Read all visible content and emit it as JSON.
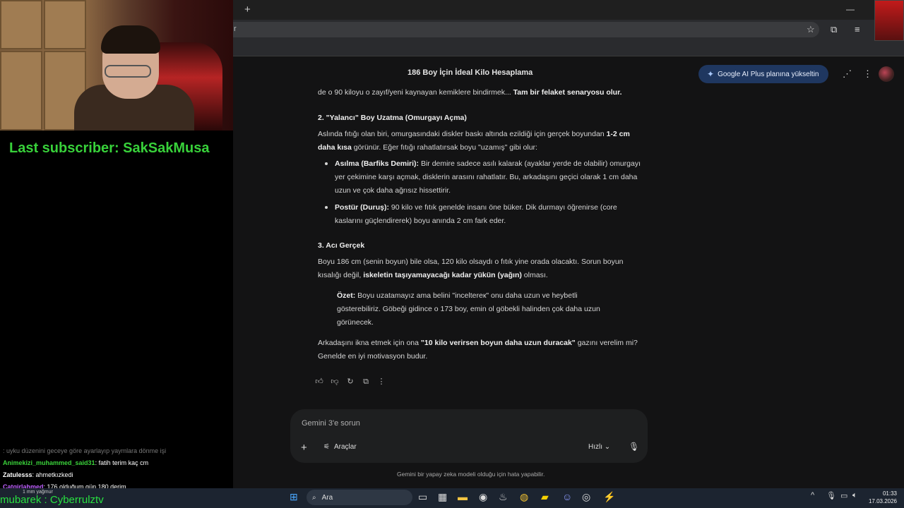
{
  "browser": {
    "new_tab_glyph": "+",
    "address_text": "r",
    "minimize_glyph": "—",
    "maximize_glyph": "▢"
  },
  "gemini": {
    "chat_title": "186 Boy İçin İdeal Kilo Hesaplama",
    "upgrade_label": "Google AI Plus planına yükseltin",
    "input_placeholder": "Gemini 3'e sorun",
    "tools_label": "Araçlar",
    "speed_label": "Hızlı",
    "disclaimer": "Gemini bir yapay zeka modeli olduğu için hata yapabilir."
  },
  "response": {
    "line1_normal": "de o 90 kiloyu o zayıf/yeni kaynayan kemiklere bindirmek... ",
    "line1_bold": "Tam bir felaket senaryosu olur.",
    "h2": "2. \"Yalancı\" Boy Uzatma (Omurgayı Açma)",
    "p2_a": "Aslında fıtığı olan biri, omurgasındaki diskler baskı altında ezildiği için gerçek boyundan ",
    "p2_b": "1-2 cm daha kısa",
    "p2_c": " görünür. Eğer fıtığı rahatlatırsak boyu \"uzamış\" gibi olur:",
    "b1_title": "Asılma (Barfiks Demiri):",
    "b1_text": " Bir demire sadece asılı kalarak (ayaklar yerde de olabilir) omurgayı yer çekimine karşı açmak, disklerin arasını rahatlatır. Bu, arkadaşını geçici olarak 1 cm daha uzun ve çok daha ağrısız hissettirir.",
    "b2_title": "Postür (Duruş):",
    "b2_text": " 90 kilo ve fıtık genelde insanı öne büker. Dik durmayı öğrenirse (core kaslarını güçlendirerek) boyu anında 2 cm fark eder.",
    "h3": "3. Acı Gerçek",
    "p3_a": "Boyu 186 cm (senin boyun) bile olsa, 120 kilo olsaydı o fıtık yine orada olacaktı. Sorun boyun kısalığı değil, ",
    "p3_b": "iskeletin taşıyamayacağı kadar yükün (yağın)",
    "p3_c": " olması.",
    "summary_title": "Özet:",
    "summary_text": " Boyu uzatamayız ama belini \"inceltereк\" onu daha uzun ve heybetli gösterebiliriz. Göbeği gidince o 173 boy, emin ol göbekli halinden çok daha uzun görünecek.",
    "closing_a": "Arkadaşını ikna etmek için ona ",
    "closing_b": "\"10 kilo verirsen boyun daha uzun duracak\"",
    "closing_c": " gazını verelim mi? Genelde en iyi motivasyon budur."
  },
  "stream": {
    "last_subscriber": "Last subscriber: SakSakMusa",
    "chat": [
      {
        "user": "",
        "message": ": uyku düzenini geceye göre ayarlayıp yaymlara dönme işi",
        "color": "#777777"
      },
      {
        "user": "Animekizi_muhammed_said31",
        "message": ": fatih terim kaç cm",
        "color": "#3ad13a"
      },
      {
        "user": "Zatulesss",
        "message": ": ahmetkızkedi",
        "color": "#ffffff"
      },
      {
        "user": "Catgirlahmed",
        "message": ": 176 olduğum gün 180 derim",
        "color": "#c060ff"
      }
    ],
    "ticker": "mubarek : Cyberrulztv",
    "weather": "1 mm yağmur"
  },
  "taskbar": {
    "search_label": "Ara",
    "time": "01:33",
    "date": "17.03.2026"
  }
}
